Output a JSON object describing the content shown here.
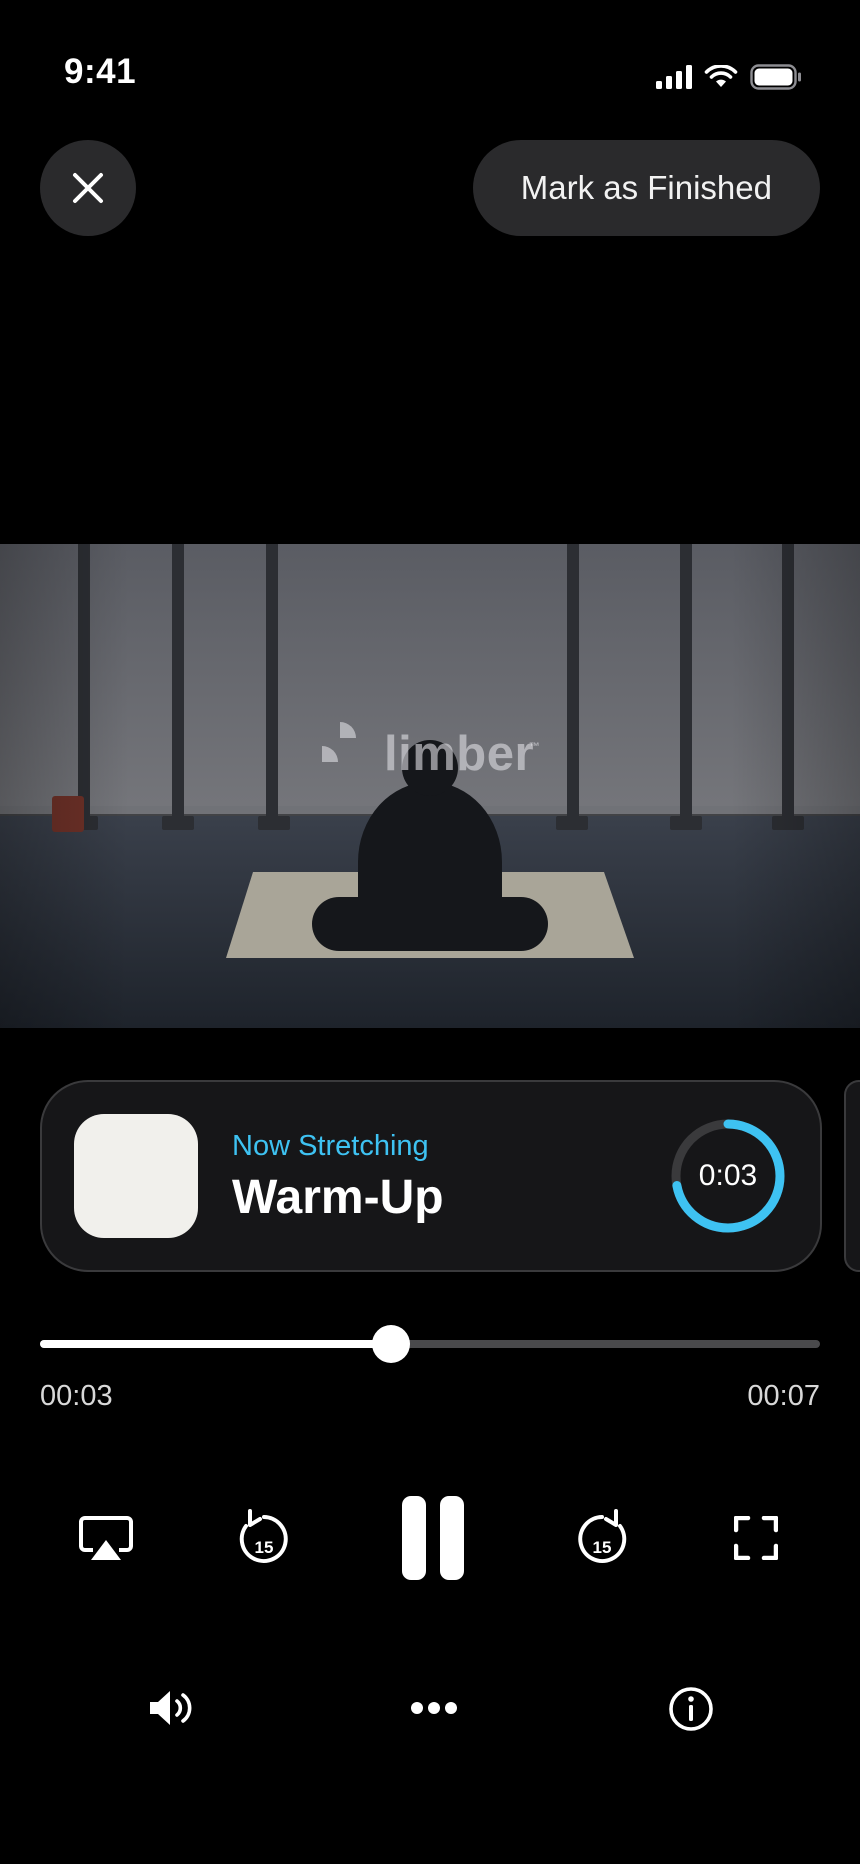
{
  "status_bar": {
    "time": "9:41"
  },
  "header": {
    "mark_finished_label": "Mark as Finished"
  },
  "video": {
    "watermark": "limber",
    "watermark_tm": "™"
  },
  "now_playing": {
    "subtitle": "Now Stretching",
    "title": "Warm-Up",
    "timer": "0:03",
    "timer_progress": 0.72
  },
  "playback": {
    "elapsed": "00:03",
    "total": "00:07",
    "progress": 0.45
  },
  "colors": {
    "accent": "#3ec2f2",
    "card_bg": "#161618",
    "button_bg": "#2a2a2c"
  },
  "icons": {
    "close": "close-icon",
    "airplay": "airplay-icon",
    "rewind": "rewind-15-icon",
    "pause": "pause-icon",
    "forward": "forward-15-icon",
    "fullscreen": "fullscreen-icon",
    "volume": "volume-icon",
    "more": "more-icon",
    "info": "info-icon"
  },
  "skip_seconds": "15"
}
